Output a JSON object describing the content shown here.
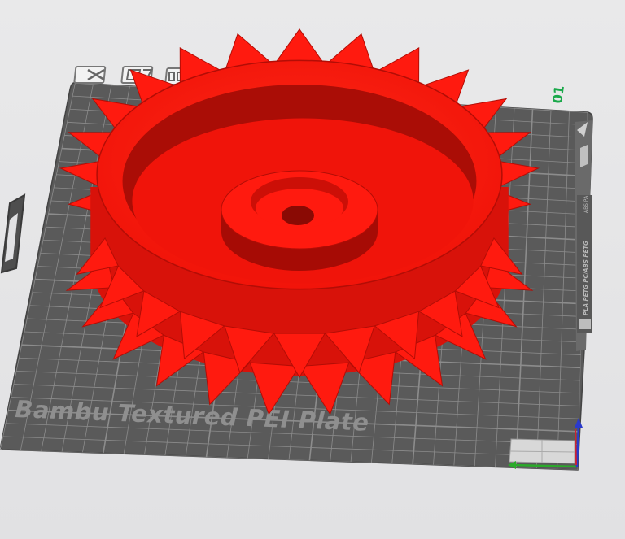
{
  "viewport": {
    "plate_name": "Bambu Textured PEI Plate",
    "plate_number": "01",
    "side_label_material": "PLA PETG PC/ABS PETG",
    "side_label_small": "ABS PA",
    "toolbar_icons": [
      "close-box-icon",
      "auto-orient-icon",
      "arrange-icon"
    ],
    "colors": {
      "model": "#ff1a0f",
      "model_dark": "#b30d06",
      "plate": "#5a5a5a",
      "grid": "#8c8c8c",
      "plate_number": "#1aa84a",
      "axis_x": "#2aaa2a",
      "axis_y": "#2a3acc",
      "axis_z": "#cc2233"
    }
  }
}
